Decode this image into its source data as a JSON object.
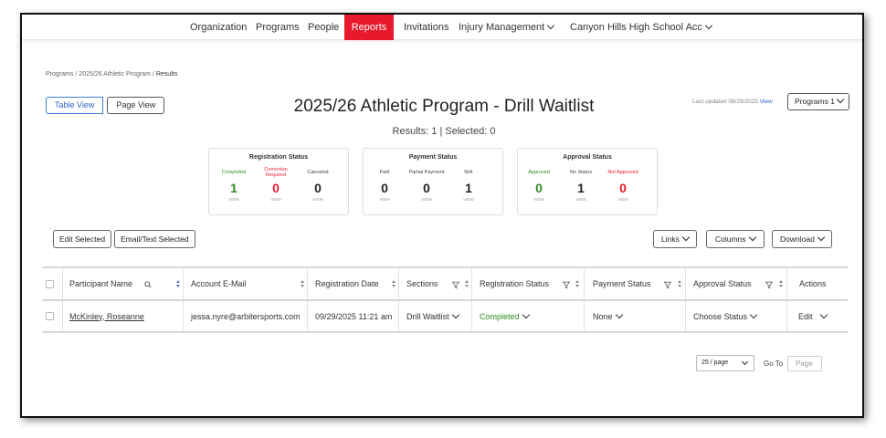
{
  "nav": {
    "items": [
      "Organization",
      "Programs",
      "People",
      "Reports",
      "Invitations",
      "Injury Management",
      "Canyon Hills High School Acc"
    ],
    "active": "Reports",
    "active_color": "#e8192c"
  },
  "breadcrumb": {
    "items": [
      "Programs",
      "2025/26 Athletic Program",
      "Results"
    ],
    "separator": "/"
  },
  "views": {
    "table": "Table View",
    "page": "Page View"
  },
  "title": "2025/26 Athletic Program - Drill Waitlist",
  "results_text": "Results: 1  |  Selected: 0",
  "last_updated": {
    "text": "Last updated 08/29/2025",
    "link": "View"
  },
  "programs_select": "Programs 1",
  "status_cards": {
    "registration": {
      "title": "Registration Status",
      "stats": [
        {
          "label": "Completed",
          "value": "1",
          "view": "VIEW",
          "color": "#2d8a1f"
        },
        {
          "label": "Correction Required",
          "value": "0",
          "view": "VIEW",
          "color": "#e8192c"
        },
        {
          "label": "Canceled",
          "value": "0",
          "view": "VIEW",
          "color": "#222222"
        }
      ]
    },
    "payment": {
      "title": "Payment Status",
      "stats": [
        {
          "label": "Paid",
          "value": "0",
          "view": "VIEW",
          "color": "#222222"
        },
        {
          "label": "Partial Payment",
          "value": "0",
          "view": "VIEW",
          "color": "#222222"
        },
        {
          "label": "N/A",
          "value": "1",
          "view": "VIEW",
          "color": "#222222"
        }
      ]
    },
    "approval": {
      "title": "Approval Status",
      "stats": [
        {
          "label": "Approved",
          "value": "0",
          "view": "VIEW",
          "color": "#2d8a1f"
        },
        {
          "label": "No Status",
          "value": "1",
          "view": "VIEW",
          "color": "#222222"
        },
        {
          "label": "Not Approved",
          "value": "0",
          "view": "VIEW",
          "color": "#e8192c"
        }
      ]
    }
  },
  "actions": {
    "edit_selected": "Edit Selected",
    "email_text_selected": "Email/Text Selected",
    "links": "Links",
    "columns": "Columns",
    "download": "Download"
  },
  "table": {
    "headers": [
      "Participant Name",
      "Account E-Mail",
      "Registration Date",
      "Sections",
      "Registration Status",
      "Payment Status",
      "Approval Status",
      "Actions"
    ],
    "rows": [
      {
        "participant": "McKinley, Roseanne",
        "email": "jessa.nyre@arbitersports.com",
        "registration_date": "09/29/2025 11:21 am",
        "section": "Drill Waitlist",
        "registration_status": "Completed",
        "payment_status": "None",
        "approval_status": "Choose Status",
        "action": "Edit"
      }
    ]
  },
  "pagination": {
    "per_page": "25 / page",
    "goto_label": "Go To",
    "goto_placeholder": "Page"
  }
}
